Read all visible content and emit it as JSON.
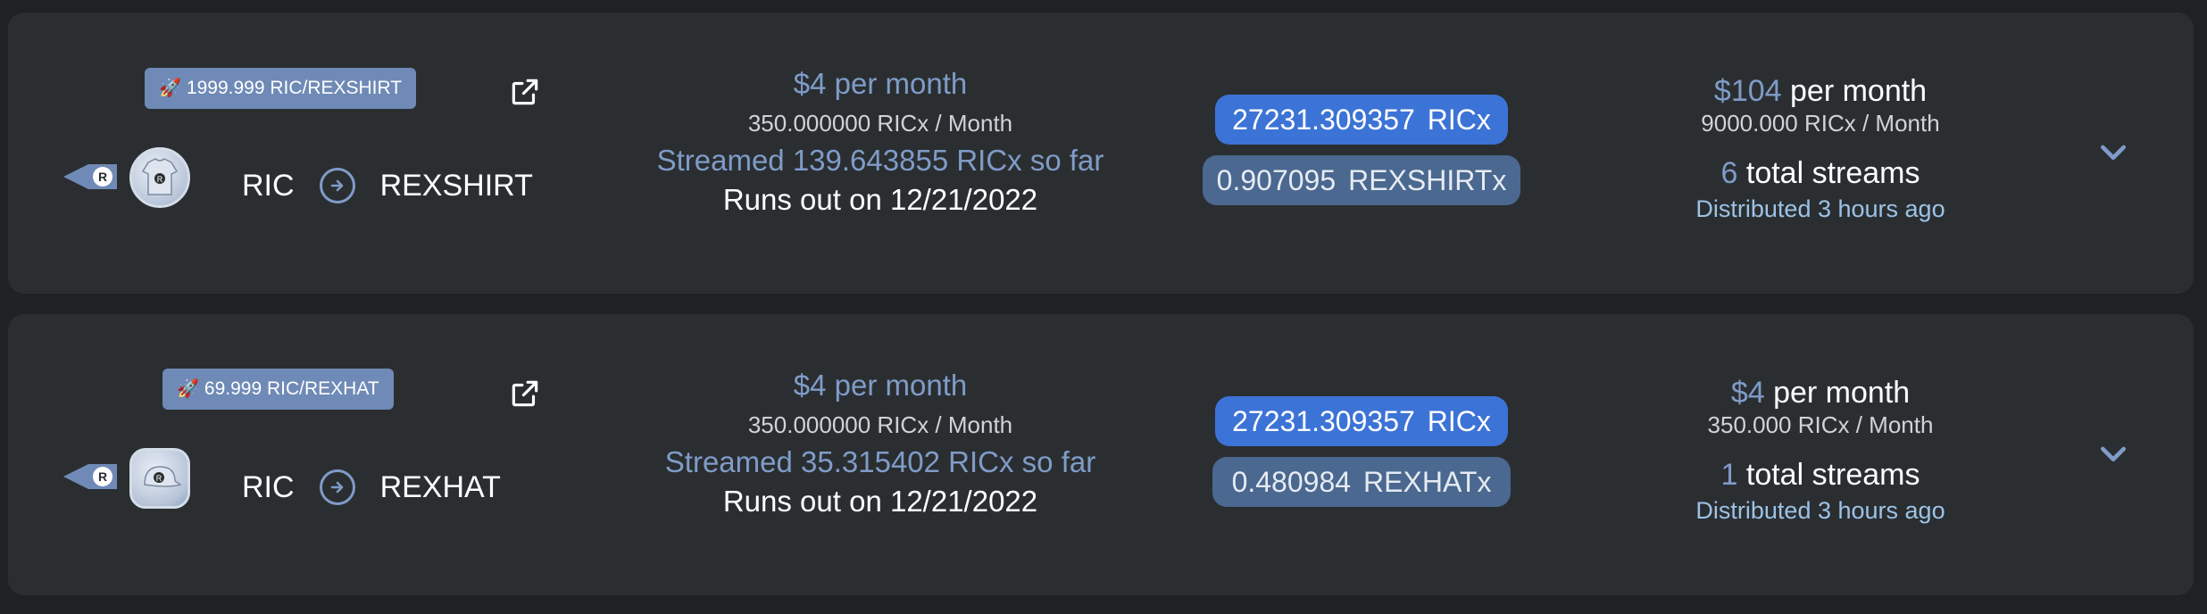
{
  "rows": [
    {
      "rate_badge": "1999.999 RIC/REXSHIRT",
      "from_token": "RIC",
      "to_token": "REXSHIRT",
      "user_rate": "$4 per month",
      "user_amount": "350.000000 RICx / Month",
      "streamed": "Streamed 139.643855 RICx so far",
      "runs_out": "Runs out on 12/21/2022",
      "balance_in_value": "27231.309357",
      "balance_in_token": "RICx",
      "balance_out_value": "0.907095",
      "balance_out_token": "REXSHIRTx",
      "total_rate_value": "$104",
      "total_rate_suffix": "per month",
      "total_amount": "9000.000 RICx / Month",
      "streams_count": "6",
      "streams_label": "total streams",
      "distributed_prefix": "Distributed",
      "distributed_time": "3 hours ago",
      "token_icon": "t-shirt-icon"
    },
    {
      "rate_badge": "69.999 RIC/REXHAT",
      "from_token": "RIC",
      "to_token": "REXHAT",
      "user_rate": "$4 per month",
      "user_amount": "350.000000 RICx / Month",
      "streamed": "Streamed 35.315402 RICx so far",
      "runs_out": "Runs out on 12/21/2022",
      "balance_in_value": "27231.309357",
      "balance_in_token": "RICx",
      "balance_out_value": "0.480984",
      "balance_out_token": "REXHATx",
      "total_rate_value": "$4",
      "total_rate_suffix": "per month",
      "total_amount": "350.000 RICx / Month",
      "streams_count": "1",
      "streams_label": "total streams",
      "distributed_prefix": "Distributed",
      "distributed_time": "3 hours ago",
      "token_icon": "cap-icon"
    }
  ],
  "colors": {
    "page_bg": "#1f2123",
    "card_bg": "#2b2e31",
    "accent_blue": "#7f9cc8",
    "pill_bright": "#3c73d6",
    "pill_muted": "#4a6890"
  },
  "icons": [
    "rocket-icon",
    "external-link-icon",
    "rex-logo-icon",
    "arrow-right-circle-icon",
    "chevron-down-icon"
  ]
}
